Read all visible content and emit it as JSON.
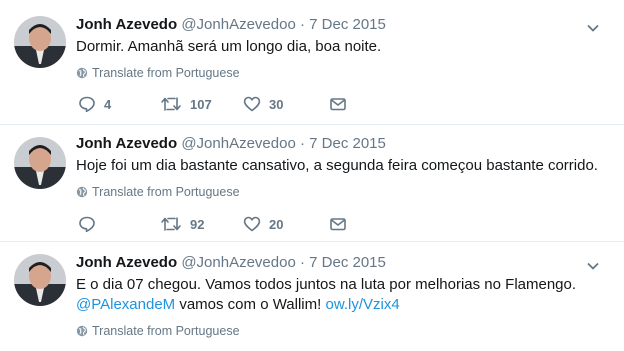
{
  "tweets": [
    {
      "name": "Jonh Azevedo",
      "handle": "@JonhAzevedoo",
      "sep": "·",
      "date": "7 Dec 2015",
      "line1": "Dormir. Amanhã será um longo dia, boa noite.",
      "translate": "Translate from Portuguese",
      "replies": "4",
      "retweets": "107",
      "likes": "30"
    },
    {
      "name": "Jonh Azevedo",
      "handle": "@JonhAzevedoo",
      "sep": "·",
      "date": "7 Dec 2015",
      "line1": "Hoje foi um dia bastante cansativo, a segunda feira começou bastante corrido.",
      "translate": "Translate from Portuguese",
      "replies": "",
      "retweets": "92",
      "likes": "20"
    },
    {
      "name": "Jonh Azevedo",
      "handle": "@JonhAzevedoo",
      "sep": "·",
      "date": "7 Dec 2015",
      "line1": "E o dia 07 chegou. Vamos todos juntos na luta por melhorias no Flamengo.",
      "mention": "@PAlexandeM",
      "line2_mid": " vamos com o Wallim! ",
      "url": "ow.ly/Vzix4",
      "translate": "Translate from Portuguese"
    }
  ],
  "icons": {
    "reply": "reply-icon",
    "retweet": "retweet-icon",
    "like": "heart-icon",
    "dm": "envelope-icon",
    "caret": "chevron-down-icon",
    "globe": "globe-icon"
  },
  "colors": {
    "link": "#1b95e0",
    "muted": "#657786",
    "divider": "#e6ecf0"
  }
}
